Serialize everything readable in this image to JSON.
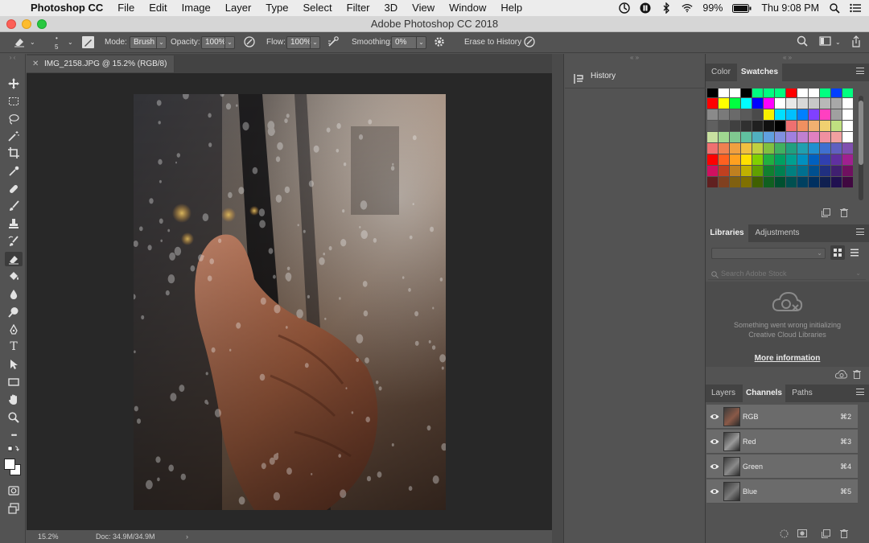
{
  "menubar": {
    "app_name": "Photoshop CC",
    "items": [
      "File",
      "Edit",
      "Image",
      "Layer",
      "Type",
      "Select",
      "Filter",
      "3D",
      "View",
      "Window",
      "Help"
    ],
    "battery": "99%",
    "clock": "Thu 9:08 PM"
  },
  "window": {
    "title": "Adobe Photoshop CC 2018"
  },
  "options": {
    "brush_size": "5",
    "mode_label": "Mode:",
    "mode_value": "Brush",
    "opacity_label": "Opacity:",
    "opacity_value": "100%",
    "flow_label": "Flow:",
    "flow_value": "100%",
    "smoothing_label": "Smoothing:",
    "smoothing_value": "0%",
    "erase_history_label": "Erase to History"
  },
  "toolbox": {
    "tools": [
      "move-tool",
      "marquee-tool",
      "lasso-tool",
      "magic-wand-tool",
      "crop-tool",
      "eyedropper-tool",
      "healing-brush-tool",
      "brush-tool",
      "clone-stamp-tool",
      "history-brush-tool",
      "eraser-tool",
      "paint-bucket-tool",
      "blur-tool",
      "dodge-tool",
      "pen-tool",
      "type-tool",
      "path-selection-tool",
      "rectangle-tool",
      "hand-tool",
      "zoom-tool",
      "more-tools",
      "color-swap",
      "color-chips",
      "quick-mask",
      "screen-mode"
    ],
    "active_tool": "eraser-tool",
    "type_tool_glyph": "T",
    "more_glyph": "•••"
  },
  "document": {
    "tab_title": "IMG_2158.JPG @ 15.2% (RGB/8)",
    "zoom": "15.2%",
    "doc_size": "Doc: 34.9M/34.9M"
  },
  "history": {
    "title": "History"
  },
  "color_panel": {
    "tabs": [
      "Color",
      "Swatches"
    ],
    "active_tab": "Swatches",
    "swatches": [
      "#000000",
      "#ffffff",
      "#ffffff",
      "#000000",
      "#00ff80",
      "#00ff80",
      "#00ff80",
      "#ff0000",
      "#ffffff",
      "#ffffff",
      "#00ff80",
      "#0040ff",
      "#00ff80",
      "#ff0000",
      "#ffff00",
      "#00ff40",
      "#00ffff",
      "#0000ff",
      "#ff00ff",
      "#ffffff",
      "#e8e8e8",
      "#d8d8d8",
      "#c8c8c8",
      "#b8b8b8",
      "#a8a8a8",
      "#ffffff",
      "#8a8a8a",
      "#7a7a7a",
      "#6a6a6a",
      "#5a5a5a",
      "#4a4a4a",
      "#f8f000",
      "#00e0ff",
      "#00c0ff",
      "#0080ff",
      "#8040ff",
      "#ff40c0",
      "#a0a0a0",
      "#ffffff",
      "#606060",
      "#505050",
      "#404040",
      "#303030",
      "#202020",
      "#101010",
      "#000000",
      "#ee7070",
      "#f09060",
      "#f0b070",
      "#f0d070",
      "#c0e080",
      "#ffffff",
      "#c8e0a0",
      "#a0d890",
      "#80c890",
      "#60c0a0",
      "#50b0c0",
      "#60a0e0",
      "#8090e0",
      "#a080e0",
      "#c080d0",
      "#e080c0",
      "#f090a0",
      "#f0a0a0",
      "#ffffff",
      "#f07070",
      "#f08050",
      "#f0a040",
      "#f0c040",
      "#c0d040",
      "#80c040",
      "#40b060",
      "#20a080",
      "#20a0b0",
      "#2090d0",
      "#4070d0",
      "#6060c0",
      "#8050b0",
      "#ff0000",
      "#ff6020",
      "#ffa020",
      "#ffe000",
      "#80d000",
      "#20b040",
      "#00a060",
      "#00a090",
      "#0090c0",
      "#0060c0",
      "#3040b0",
      "#6030a0",
      "#a02090",
      "#d01060",
      "#c04020",
      "#c08020",
      "#c0b000",
      "#60a000",
      "#108030",
      "#008050",
      "#008080",
      "#007090",
      "#005090",
      "#203080",
      "#402070",
      "#701060",
      "#602020",
      "#804020",
      "#806010",
      "#807000",
      "#406000",
      "#106020",
      "#005030",
      "#005050",
      "#004060",
      "#003060",
      "#102050",
      "#201050",
      "#400840"
    ]
  },
  "libraries_panel": {
    "tabs": [
      "Libraries",
      "Adjustments"
    ],
    "active_tab": "Libraries",
    "search_placeholder": "Search Adobe Stock",
    "error_message_line1": "Something went wrong initializing",
    "error_message_line2": "Creative Cloud Libraries",
    "more_info_link": "More information"
  },
  "layers_panel": {
    "tabs": [
      "Layers",
      "Channels",
      "Paths"
    ],
    "active_tab": "Channels",
    "channels": [
      {
        "name": "RGB",
        "shortcut": "⌘2"
      },
      {
        "name": "Red",
        "shortcut": "⌘3"
      },
      {
        "name": "Green",
        "shortcut": "⌘4"
      },
      {
        "name": "Blue",
        "shortcut": "⌘5"
      }
    ]
  },
  "colors": {
    "menubar_bg": "#ececec",
    "ui_gray": "#535353",
    "canvas_bg": "#282828",
    "close_red": "#fc5f57",
    "min_yellow": "#fdbc2e",
    "max_green": "#28c840"
  }
}
